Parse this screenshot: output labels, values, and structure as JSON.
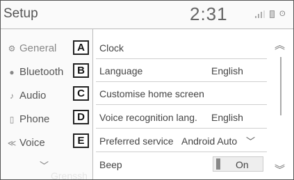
{
  "header": {
    "title": "Setup",
    "time": "2:31",
    "bluetooth_glyph": "ʘ"
  },
  "sidebar": {
    "items": [
      {
        "label": "General",
        "icon": "gear-icon"
      },
      {
        "label": "Bluetooth",
        "icon": "bluetooth-icon"
      },
      {
        "label": "Audio",
        "icon": "music-note-icon"
      },
      {
        "label": "Phone",
        "icon": "phone-icon"
      },
      {
        "label": "Voice",
        "icon": "voice-icon"
      }
    ],
    "watermark": "Grenssh"
  },
  "callouts": [
    "A",
    "B",
    "C",
    "D",
    "E"
  ],
  "rows": [
    {
      "label": "Clock",
      "value": ""
    },
    {
      "label": "Language",
      "value": "English"
    },
    {
      "label": "Customise home screen",
      "value": ""
    },
    {
      "label": "Voice recognition lang.",
      "value": "English"
    },
    {
      "label": "Preferred service",
      "value": "Android Auto"
    },
    {
      "label": "Beep",
      "value": "On"
    }
  ],
  "colors": {
    "background": "#ffffff",
    "text": "#444444",
    "divider": "#cfcfcf"
  }
}
